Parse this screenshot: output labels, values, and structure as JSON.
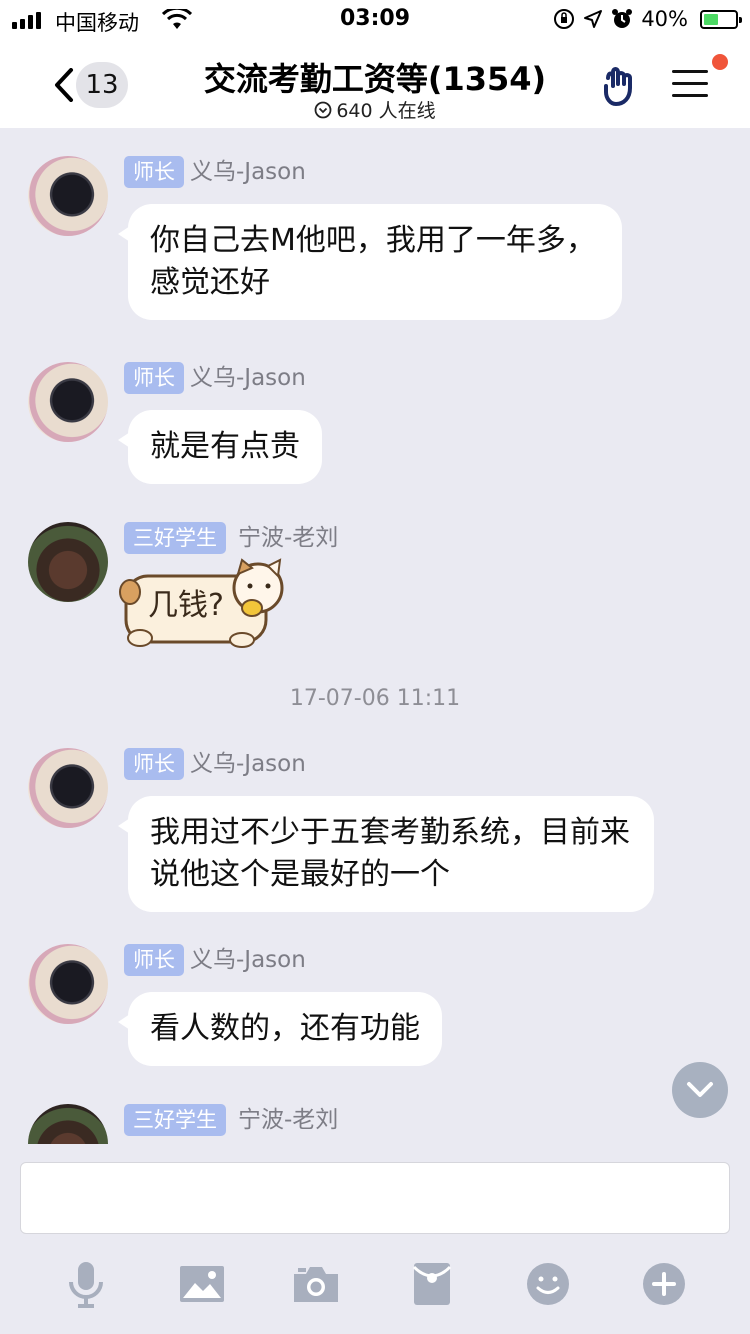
{
  "status_bar": {
    "carrier": "中国移动",
    "time": "03:09",
    "battery": "40%",
    "battery_level": 0.4
  },
  "nav": {
    "back_count": "13",
    "title": "交流考勤工资等(1354)",
    "online": "640 人在线"
  },
  "messages": [
    {
      "tag": "师长",
      "sender": "义乌-Jason",
      "text": "你自己去M他吧，我用了一年多，感觉还好"
    },
    {
      "tag": "师长",
      "sender": "义乌-Jason",
      "text": "就是有点贵"
    },
    {
      "tag": "三好学生",
      "sender": "宁波-老刘",
      "sticker_text": "几钱?"
    },
    {
      "tag": "师长",
      "sender": "义乌-Jason",
      "text": "我用过不少于五套考勤系统，目前来说他这个是最好的一个"
    },
    {
      "tag": "师长",
      "sender": "义乌-Jason",
      "text": "看人数的，还有功能"
    },
    {
      "tag": "三好学生",
      "sender": "宁波-老刘"
    }
  ],
  "timestamp": "17-07-06 11:11",
  "colors": {
    "background": "#eaeaf2",
    "tag": "#a9bcef",
    "notification_dot": "#f0553a",
    "toolbar_icon": "#a8afbe"
  },
  "toolbar": [
    "microphone-icon",
    "image-icon",
    "camera-icon",
    "red-packet-icon",
    "emoji-icon",
    "plus-icon"
  ]
}
